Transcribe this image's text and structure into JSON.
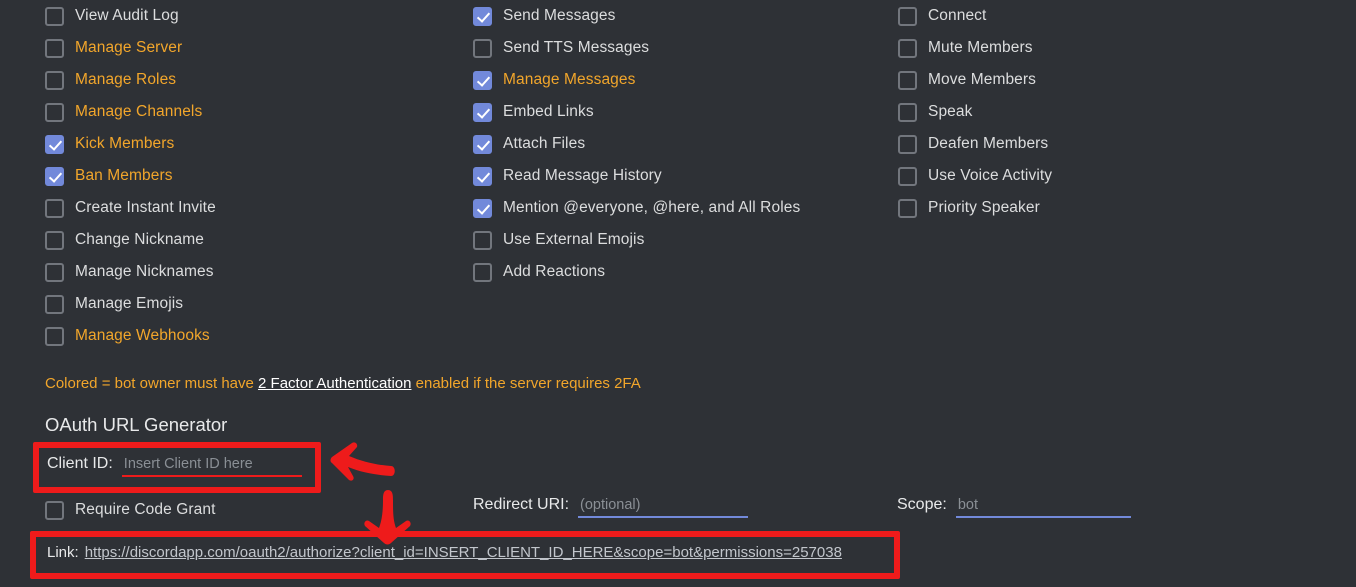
{
  "background_color": "#2e3136",
  "accent_colors": {
    "colored_permission": "#f2a62b",
    "checkbox_checked": "#7289da",
    "annotation_red": "#ee1b1b",
    "field_underline": "#7289da",
    "text": "#dcddde"
  },
  "permissions": {
    "general": [
      {
        "label": "View Audit Log",
        "checked": false,
        "colored": false
      },
      {
        "label": "Manage Server",
        "checked": false,
        "colored": true
      },
      {
        "label": "Manage Roles",
        "checked": false,
        "colored": true
      },
      {
        "label": "Manage Channels",
        "checked": false,
        "colored": true
      },
      {
        "label": "Kick Members",
        "checked": true,
        "colored": true
      },
      {
        "label": "Ban Members",
        "checked": true,
        "colored": true
      },
      {
        "label": "Create Instant Invite",
        "checked": false,
        "colored": false
      },
      {
        "label": "Change Nickname",
        "checked": false,
        "colored": false
      },
      {
        "label": "Manage Nicknames",
        "checked": false,
        "colored": false
      },
      {
        "label": "Manage Emojis",
        "checked": false,
        "colored": false
      },
      {
        "label": "Manage Webhooks",
        "checked": false,
        "colored": true
      }
    ],
    "text": [
      {
        "label": "Send Messages",
        "checked": true,
        "colored": false
      },
      {
        "label": "Send TTS Messages",
        "checked": false,
        "colored": false
      },
      {
        "label": "Manage Messages",
        "checked": true,
        "colored": true
      },
      {
        "label": "Embed Links",
        "checked": true,
        "colored": false
      },
      {
        "label": "Attach Files",
        "checked": true,
        "colored": false
      },
      {
        "label": "Read Message History",
        "checked": true,
        "colored": false
      },
      {
        "label": "Mention @everyone, @here, and All Roles",
        "checked": true,
        "colored": false
      },
      {
        "label": "Use External Emojis",
        "checked": false,
        "colored": false
      },
      {
        "label": "Add Reactions",
        "checked": false,
        "colored": false
      }
    ],
    "voice": [
      {
        "label": "Connect",
        "checked": false,
        "colored": false
      },
      {
        "label": "Mute Members",
        "checked": false,
        "colored": false
      },
      {
        "label": "Move Members",
        "checked": false,
        "colored": false
      },
      {
        "label": "Speak",
        "checked": false,
        "colored": false
      },
      {
        "label": "Deafen Members",
        "checked": false,
        "colored": false
      },
      {
        "label": "Use Voice Activity",
        "checked": false,
        "colored": false
      },
      {
        "label": "Priority Speaker",
        "checked": false,
        "colored": false
      }
    ]
  },
  "twofa_note": {
    "before": "Colored = bot owner must have ",
    "link": "2 Factor Authentication",
    "after": " enabled if the server requires 2FA"
  },
  "oauth": {
    "heading": "OAuth URL Generator",
    "client_id": {
      "label": "Client ID:",
      "value": "",
      "placeholder": "Insert Client ID here"
    },
    "require_code_grant": {
      "label": "Require Code Grant",
      "checked": false
    },
    "redirect_uri": {
      "label": "Redirect URI:",
      "value": "",
      "placeholder": "(optional)"
    },
    "scope": {
      "label": "Scope:",
      "value": "",
      "placeholder": "bot"
    },
    "link": {
      "label": "Link:",
      "url": "https://discordapp.com/oauth2/authorize?client_id=INSERT_CLIENT_ID_HERE&scope=bot&permissions=257038"
    }
  },
  "annotations": {
    "arrow_left": "arrow-left-icon",
    "arrow_down": "arrow-down-icon"
  }
}
